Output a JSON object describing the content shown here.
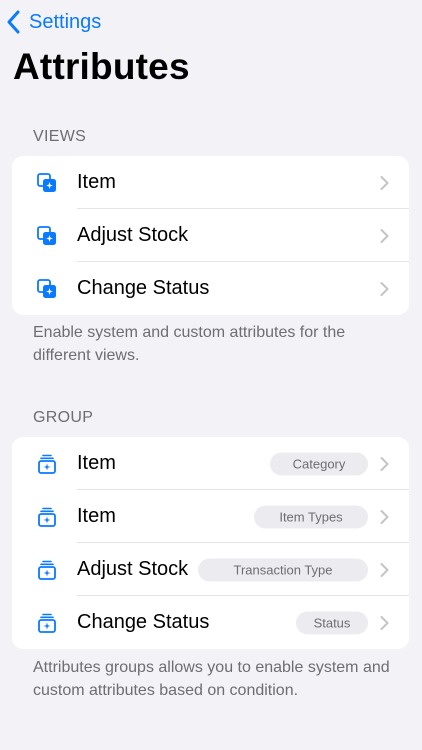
{
  "nav": {
    "back_label": "Settings"
  },
  "page": {
    "title": "Attributes"
  },
  "views": {
    "header": "VIEWS",
    "items": [
      {
        "label": "Item",
        "icon": "view-attribute-icon"
      },
      {
        "label": "Adjust Stock",
        "icon": "view-attribute-icon"
      },
      {
        "label": "Change Status",
        "icon": "view-attribute-icon"
      }
    ],
    "footer": "Enable system and custom attributes for the different views."
  },
  "group": {
    "header": "GROUP",
    "items": [
      {
        "label": "Item",
        "badge": "Category",
        "icon": "group-attribute-icon"
      },
      {
        "label": "Item",
        "badge": "Item Types",
        "icon": "group-attribute-icon"
      },
      {
        "label": "Adjust Stock",
        "badge": "Transaction Type",
        "icon": "group-attribute-icon"
      },
      {
        "label": "Change Status",
        "badge": "Status",
        "icon": "group-attribute-icon"
      }
    ],
    "footer": "Attributes groups allows you to enable system and custom attributes based on condition."
  },
  "colors": {
    "accent": "#0a7aff",
    "background": "#f2f2f7",
    "secondary_text": "#6d6d72"
  }
}
